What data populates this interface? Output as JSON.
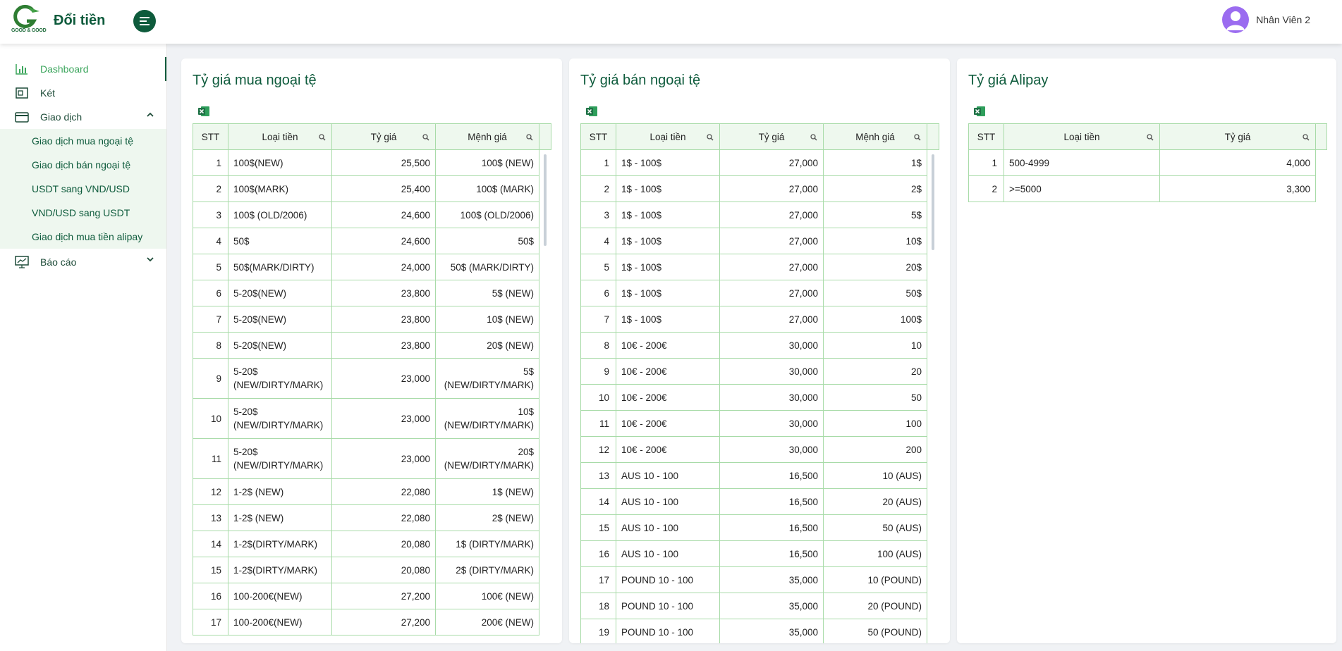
{
  "header": {
    "logo_text": "GOOD & GOOD",
    "app_title": "Đổi tiền",
    "user_name": "Nhân Viên 2"
  },
  "sidebar": {
    "items": [
      {
        "label": "Dashboard",
        "icon": "bar-chart-icon",
        "active": true
      },
      {
        "label": "Két",
        "icon": "safe-icon"
      },
      {
        "label": "Giao dịch",
        "icon": "card-icon",
        "expanded": true
      },
      {
        "label": "Báo cáo",
        "icon": "presentation-icon",
        "expanded": false
      }
    ],
    "sub_items": [
      {
        "label": "Giao dịch mua ngoại tệ"
      },
      {
        "label": "Giao dịch bán ngoại tệ"
      },
      {
        "label": "USDT sang VND/USD"
      },
      {
        "label": "VND/USD sang USDT"
      },
      {
        "label": "Giao dịch mua tiền alipay"
      }
    ]
  },
  "colors": {
    "brand": "#0e5b3c",
    "accent": "#3ba55c",
    "table_border": "#a8dba8",
    "table_header_bg": "#eef8ee",
    "avatar": "#9b6cf0"
  },
  "buy_table": {
    "title": "Tỷ giá mua ngoại tệ",
    "columns": [
      "STT",
      "Loại tiền",
      "Tỷ giá",
      "Mệnh giá"
    ],
    "rows": [
      [
        "1",
        "100$(NEW)",
        "25,500",
        "100$ (NEW)"
      ],
      [
        "2",
        "100$(MARK)",
        "25,400",
        "100$ (MARK)"
      ],
      [
        "3",
        "100$ (OLD/2006)",
        "24,600",
        "100$ (OLD/2006)"
      ],
      [
        "4",
        "50$",
        "24,600",
        "50$"
      ],
      [
        "5",
        "50$(MARK/DIRTY)",
        "24,000",
        "50$ (MARK/DIRTY)"
      ],
      [
        "6",
        "5-20$(NEW)",
        "23,800",
        "5$ (NEW)"
      ],
      [
        "7",
        "5-20$(NEW)",
        "23,800",
        "10$ (NEW)"
      ],
      [
        "8",
        "5-20$(NEW)",
        "23,800",
        "20$ (NEW)"
      ],
      [
        "9",
        "5-20$ (NEW/DIRTY/MARK)",
        "23,000",
        "5$ (NEW/DIRTY/MARK)"
      ],
      [
        "10",
        "5-20$ (NEW/DIRTY/MARK)",
        "23,000",
        "10$ (NEW/DIRTY/MARK)"
      ],
      [
        "11",
        "5-20$ (NEW/DIRTY/MARK)",
        "23,000",
        "20$ (NEW/DIRTY/MARK)"
      ],
      [
        "12",
        "1-2$ (NEW)",
        "22,080",
        "1$ (NEW)"
      ],
      [
        "13",
        "1-2$ (NEW)",
        "22,080",
        "2$ (NEW)"
      ],
      [
        "14",
        "1-2$(DIRTY/MARK)",
        "20,080",
        "1$ (DIRTY/MARK)"
      ],
      [
        "15",
        "1-2$(DIRTY/MARK)",
        "20,080",
        "2$ (DIRTY/MARK)"
      ],
      [
        "16",
        "100-200€(NEW)",
        "27,200",
        "100€ (NEW)"
      ],
      [
        "17",
        "100-200€(NEW)",
        "27,200",
        "200€ (NEW)"
      ]
    ]
  },
  "sell_table": {
    "title": "Tỷ giá bán ngoại tệ",
    "columns": [
      "STT",
      "Loại tiền",
      "Tỷ giá",
      "Mệnh giá"
    ],
    "rows": [
      [
        "1",
        "1$ - 100$",
        "27,000",
        "1$"
      ],
      [
        "2",
        "1$ - 100$",
        "27,000",
        "2$"
      ],
      [
        "3",
        "1$ - 100$",
        "27,000",
        "5$"
      ],
      [
        "4",
        "1$ - 100$",
        "27,000",
        "10$"
      ],
      [
        "5",
        "1$ - 100$",
        "27,000",
        "20$"
      ],
      [
        "6",
        "1$ - 100$",
        "27,000",
        "50$"
      ],
      [
        "7",
        "1$ - 100$",
        "27,000",
        "100$"
      ],
      [
        "8",
        "10€ - 200€",
        "30,000",
        "10"
      ],
      [
        "9",
        "10€ - 200€",
        "30,000",
        "20"
      ],
      [
        "10",
        "10€ - 200€",
        "30,000",
        "50"
      ],
      [
        "11",
        "10€ - 200€",
        "30,000",
        "100"
      ],
      [
        "12",
        "10€ - 200€",
        "30,000",
        "200"
      ],
      [
        "13",
        "AUS 10 - 100",
        "16,500",
        "10 (AUS)"
      ],
      [
        "14",
        "AUS 10 - 100",
        "16,500",
        "20 (AUS)"
      ],
      [
        "15",
        "AUS 10 - 100",
        "16,500",
        "50 (AUS)"
      ],
      [
        "16",
        "AUS 10 - 100",
        "16,500",
        "100 (AUS)"
      ],
      [
        "17",
        "POUND 10 - 100",
        "35,000",
        "10 (POUND)"
      ],
      [
        "18",
        "POUND 10 - 100",
        "35,000",
        "20 (POUND)"
      ],
      [
        "19",
        "POUND 10 - 100",
        "35,000",
        "50 (POUND)"
      ]
    ]
  },
  "alipay_table": {
    "title": "Tỷ giá Alipay",
    "columns": [
      "STT",
      "Loại tiền",
      "Tỷ giá"
    ],
    "rows": [
      [
        "1",
        "500-4999",
        "4,000"
      ],
      [
        "2",
        ">=5000",
        "3,300"
      ]
    ]
  }
}
